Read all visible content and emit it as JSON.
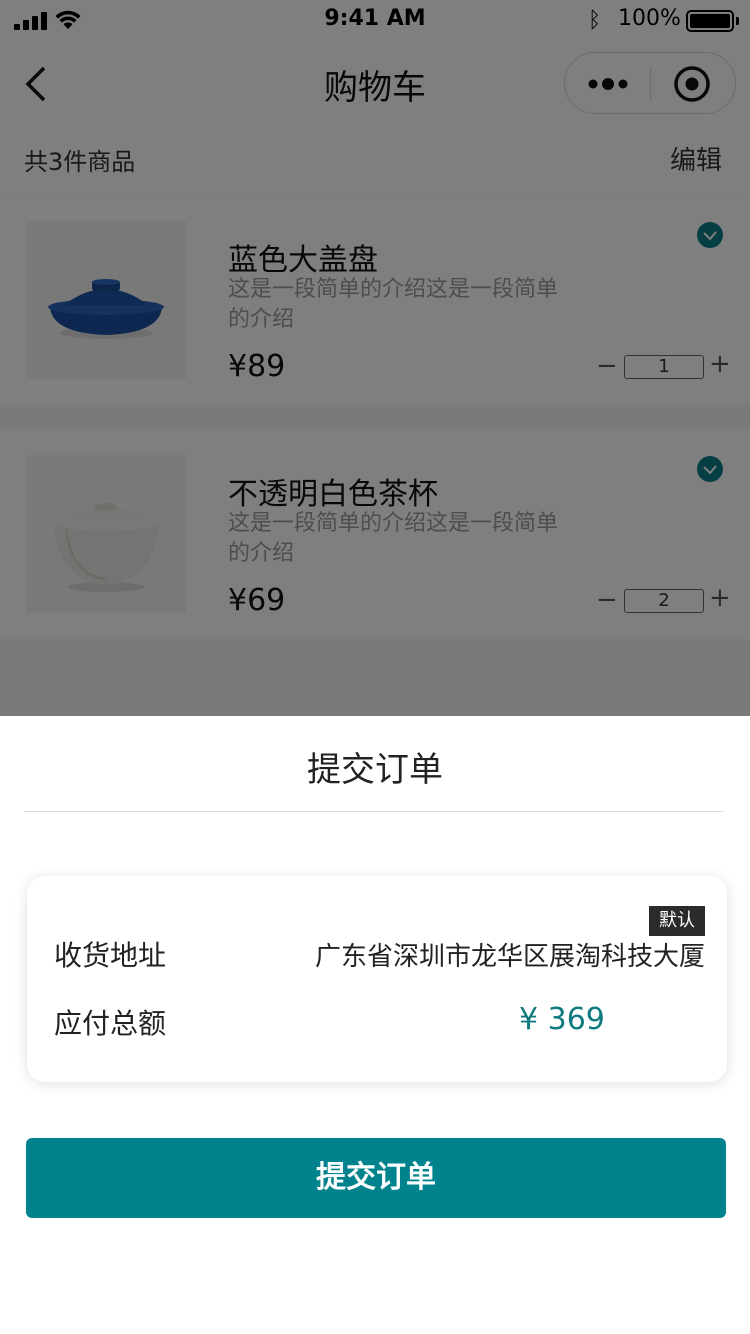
{
  "status_bar": {
    "time": "9:41 AM",
    "battery": "100%"
  },
  "nav": {
    "title": "购物车"
  },
  "cart": {
    "count_text": "共3件商品",
    "edit_label": "编辑",
    "items": [
      {
        "title": "蓝色大盖盘",
        "desc": "这是一段简单的介绍这是一段简单的介绍",
        "price": "¥89",
        "qty": "1",
        "minus": "−",
        "plus": "+"
      },
      {
        "title": "不透明白色茶杯",
        "desc": "这是一段简单的介绍这是一段简单的介绍",
        "price": "¥69",
        "qty": "2",
        "minus": "−",
        "plus": "+"
      }
    ]
  },
  "sheet": {
    "title": "提交订单",
    "default_tag": "默认",
    "address_label": "收货地址",
    "address_value": "广东省深圳市龙华区展淘科技大厦",
    "amount_label": "应付总额",
    "amount_value": "¥ 369",
    "submit_label": "提交订单"
  },
  "colors": {
    "accent": "#00838d",
    "amount": "#0f7a80",
    "overlay": "rgba(0,0,0,0.5)"
  },
  "icons": [
    "signal-icon",
    "wifi-icon",
    "bluetooth-icon",
    "battery-icon",
    "back-icon",
    "more-icon",
    "target-icon",
    "check-icon"
  ]
}
